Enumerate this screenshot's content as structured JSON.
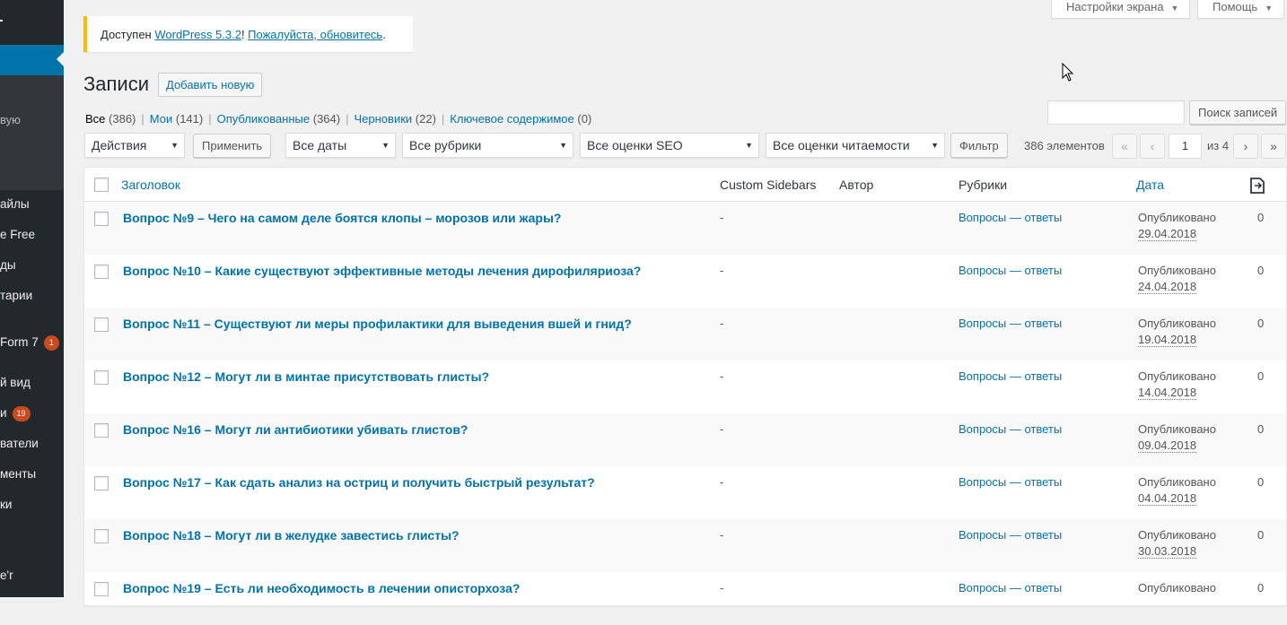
{
  "sidebar": {
    "items": [
      {
        "label": "вую",
        "sub": true
      },
      {
        "label": "айлы"
      },
      {
        "label": "e Free"
      },
      {
        "label": "ды"
      },
      {
        "label": "тарии"
      },
      {
        "label": "Form 7",
        "count": "1"
      },
      {
        "label": "й вид"
      },
      {
        "label": "и",
        "count": "19"
      },
      {
        "label": "ватели"
      },
      {
        "label": "менты"
      },
      {
        "label": "ки"
      },
      {
        "label": "e'r"
      }
    ]
  },
  "screen_meta": {
    "screen_options_label": "Настройки экрана",
    "help_label": "Помощь"
  },
  "update_nag": {
    "prefix": "Доступен ",
    "version_link": "WordPress 5.3.2",
    "middle": "! ",
    "update_link": "Пожалуйста, обновитесь",
    "suffix": "."
  },
  "header": {
    "title": "Записи",
    "add_new_label": "Добавить новую"
  },
  "views": [
    {
      "label": "Все",
      "count": "(386)",
      "current": true
    },
    {
      "label": "Мои",
      "count": "(141)"
    },
    {
      "label": "Опубликованные",
      "count": "(364)"
    },
    {
      "label": "Черновики",
      "count": "(22)"
    },
    {
      "label": "Ключевое содержимое",
      "count": "(0)"
    }
  ],
  "search": {
    "value": "",
    "button_label": "Поиск записей"
  },
  "tablenav": {
    "bulk_action": "Действия",
    "apply_label": "Применить",
    "dates": "Все даты",
    "categories": "Все рубрики",
    "seo": "Все оценки SEO",
    "readability": "Все оценки читаемости",
    "filter_label": "Фильтр",
    "items_count": "386 элементов",
    "first": "«",
    "prev": "‹",
    "current_page": "1",
    "of_total": "из 4",
    "next": "›",
    "last": "»"
  },
  "table": {
    "columns": {
      "title": "Заголовок",
      "sidebars": "Custom Sidebars",
      "author": "Автор",
      "categories": "Рубрики",
      "date": "Дата"
    },
    "rows": [
      {
        "title": "Вопрос №9 – Чего на самом деле боятся клопы – морозов или жары?",
        "sidebars": "-",
        "category": "Вопросы — ответы",
        "status": "Опубликовано",
        "date": "29.04.2018",
        "comments": "0"
      },
      {
        "title": "Вопрос №10 – Какие существуют эффективные методы лечения дирофиляриоза?",
        "sidebars": "-",
        "category": "Вопросы — ответы",
        "status": "Опубликовано",
        "date": "24.04.2018",
        "comments": "0"
      },
      {
        "title": "Вопрос №11 – Существуют ли меры профилактики для выведения вшей и гнид?",
        "sidebars": "-",
        "category": "Вопросы — ответы",
        "status": "Опубликовано",
        "date": "19.04.2018",
        "comments": "0"
      },
      {
        "title": "Вопрос №12 – Могут ли в минтае присутствовать глисты?",
        "sidebars": "-",
        "category": "Вопросы — ответы",
        "status": "Опубликовано",
        "date": "14.04.2018",
        "comments": "0"
      },
      {
        "title": "Вопрос №16 – Могут ли антибиотики убивать глистов?",
        "sidebars": "-",
        "category": "Вопросы — ответы",
        "status": "Опубликовано",
        "date": "09.04.2018",
        "comments": "0"
      },
      {
        "title": "Вопрос №17 – Как сдать анализ на остриц и получить быстрый результат?",
        "sidebars": "-",
        "category": "Вопросы — ответы",
        "status": "Опубликовано",
        "date": "04.04.2018",
        "comments": "0"
      },
      {
        "title": "Вопрос №18 – Могут ли в желудке завестись глисты?",
        "sidebars": "-",
        "category": "Вопросы — ответы",
        "status": "Опубликовано",
        "date": "30.03.2018",
        "comments": "0"
      },
      {
        "title": "Вопрос №19 – Есть ли необходимость в лечении описторхоза?",
        "sidebars": "-",
        "category": "Вопросы — ответы",
        "status": "Опубликовано",
        "date": "",
        "comments": "0"
      }
    ]
  }
}
